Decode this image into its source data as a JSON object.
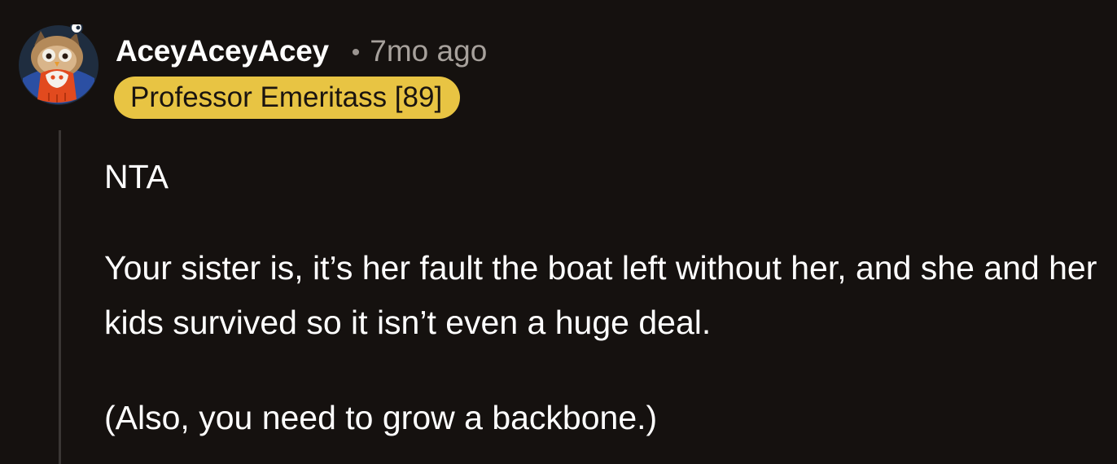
{
  "comment": {
    "author": "AceyAceyAcey",
    "separator": "•",
    "timestamp": "7mo ago",
    "flair": "Professor Emeritass [89]",
    "avatar_icon": "owl-avatar-icon",
    "flair_color": "#e8c443",
    "paragraphs": [
      "NTA",
      "Your sister is, it’s her fault the boat left without her, and she and her kids survived so it isn’t even a huge deal.",
      "(Also, you need to grow a backbone.)"
    ]
  }
}
